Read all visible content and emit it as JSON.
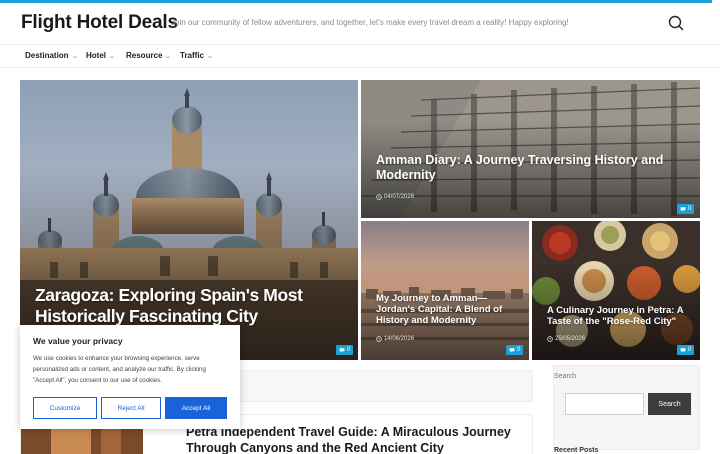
{
  "site": {
    "title": "Flight Hotel Deals",
    "tagline": "Join our community of fellow adventurers, and together, let's make every travel dream a reality! Happy exploring!"
  },
  "nav": [
    {
      "label": "Destination"
    },
    {
      "label": "Hotel"
    },
    {
      "label": "Resource"
    },
    {
      "label": "Traffic"
    }
  ],
  "cards": [
    {
      "title": "Zaragoza: Exploring Spain's Most Historically Fascinating City",
      "date": "",
      "comments": "0"
    },
    {
      "title": "Amman Diary: A Journey Traversing History and Modernity",
      "date": "04/07/2026",
      "comments": "0"
    },
    {
      "title": "My Journey to Amman—Jordan's Capital: A Blend of History and Modernity",
      "date": "14/06/2026",
      "comments": "0"
    },
    {
      "title": "A Culinary Journey in Petra: A Taste of the \"Rose-Red City\"",
      "date": "25/05/2026",
      "comments": "0"
    }
  ],
  "cookie": {
    "title": "We value your privacy",
    "text": "We use cookies to enhance your browsing experience, serve personalized ads or content, and analyze our traffic. By clicking \"Accept All\", you consent to our use of cookies.",
    "customize": "Customize",
    "reject": "Reject All",
    "accept": "Accept All"
  },
  "post": {
    "title": "Petra Independent Travel Guide: A Miraculous Journey Through Canyons and the Red Ancient City"
  },
  "sidebar": {
    "search_label": "Search",
    "search_button": "Search",
    "search_value": "",
    "next_heading": "Recent Posts"
  },
  "icons": {
    "search": "search-icon",
    "clock": "clock-icon",
    "comment": "comment-icon",
    "chevron": "chevron-down-icon"
  },
  "colors": {
    "accent": "#1ca0d8",
    "cookie_button": "#1863dc",
    "search_button": "#3c3c3c"
  }
}
